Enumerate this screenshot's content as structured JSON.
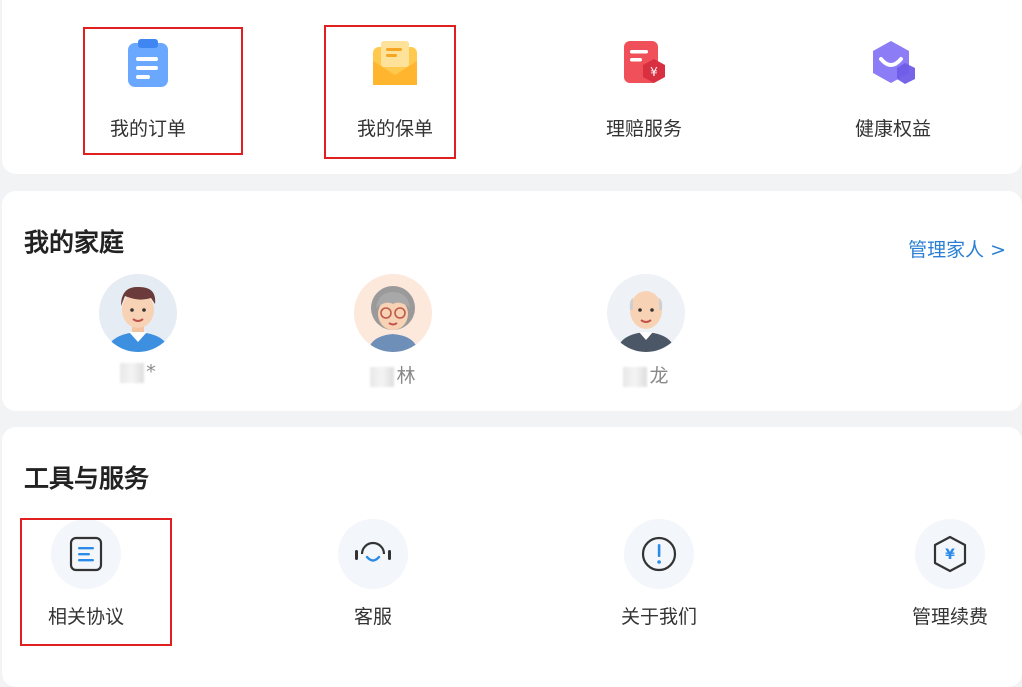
{
  "top_menu": {
    "items": [
      {
        "label": "我的订单",
        "icon": "order-clipboard-icon",
        "color": "#6aa8ff"
      },
      {
        "label": "我的保单",
        "icon": "policy-envelope-icon",
        "color": "#ffc94d"
      },
      {
        "label": "理赔服务",
        "icon": "claim-document-yuan-icon",
        "color": "#f0505a"
      },
      {
        "label": "健康权益",
        "icon": "health-benefit-hexagon-icon",
        "color": "#8c7cf6"
      }
    ]
  },
  "family": {
    "title": "我的家庭",
    "manage_label": "管理家人",
    "members": [
      {
        "name_suffix": "*",
        "avatar": "young-man-avatar"
      },
      {
        "name_suffix": "林",
        "avatar": "elderly-woman-avatar"
      },
      {
        "name_suffix": "龙",
        "avatar": "elderly-man-avatar"
      }
    ]
  },
  "tools": {
    "title": "工具与服务",
    "items": [
      {
        "label": "相关协议",
        "icon": "agreement-document-icon"
      },
      {
        "label": "客服",
        "icon": "headset-icon"
      },
      {
        "label": "关于我们",
        "icon": "info-exclamation-icon"
      },
      {
        "label": "管理续费",
        "icon": "renewal-yuan-hexagon-icon"
      }
    ]
  },
  "colors": {
    "accent_link": "#2a7fd4",
    "highlight_box": "#e02020",
    "tool_icon_accent": "#2a8be8"
  }
}
